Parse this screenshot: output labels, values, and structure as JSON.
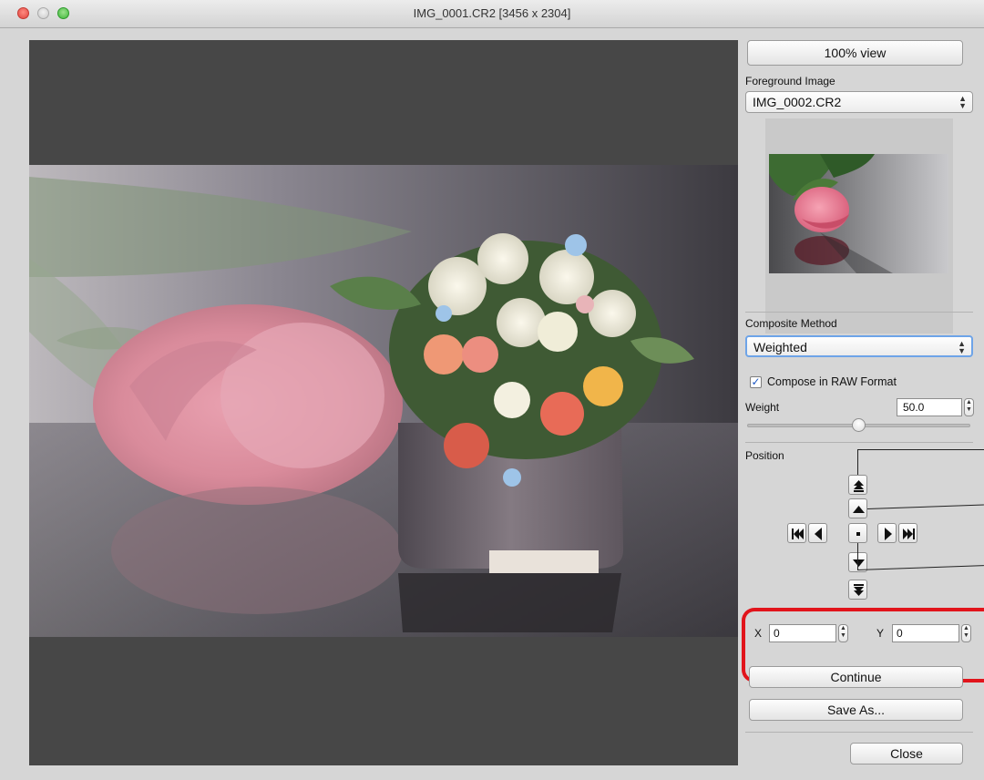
{
  "window": {
    "title": "IMG_0001.CR2 [3456 x 2304]"
  },
  "panel": {
    "view_button": "100% view",
    "foreground_label": "Foreground Image",
    "foreground_value": "IMG_0002.CR2",
    "composite_label": "Composite Method",
    "composite_value": "Weighted",
    "compose_raw_label": "Compose in RAW Format",
    "compose_raw_checked": true,
    "weight_label": "Weight",
    "weight_value": "50.0",
    "weight_fraction": 0.5,
    "position_label": "Position",
    "x_label": "X",
    "x_value": "0",
    "y_label": "Y",
    "y_value": "0",
    "continue_button": "Continue",
    "save_as_button": "Save As...",
    "close_button": "Close"
  },
  "colors": {
    "highlight": "#e1141b",
    "focus_ring": "#6ea4e8"
  },
  "icons": {
    "move_up_fast": "double-up-arrow-icon",
    "move_up": "up-arrow-icon",
    "move_left_fast": "double-left-arrow-icon",
    "move_left": "left-arrow-icon",
    "center": "center-dot-icon",
    "move_right": "right-arrow-icon",
    "move_right_fast": "double-right-arrow-icon",
    "move_down": "down-arrow-icon",
    "move_down_fast": "double-down-arrow-icon"
  }
}
